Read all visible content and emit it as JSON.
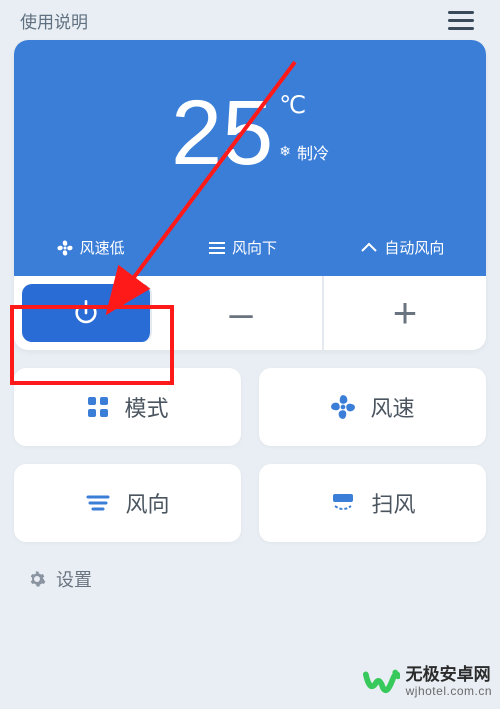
{
  "topbar": {
    "title": "使用说明"
  },
  "display": {
    "temp_value": "25",
    "temp_unit": "℃",
    "mode_label": "制冷",
    "status": {
      "fan_speed": "风速低",
      "wind_dir": "风向下",
      "auto_dir": "自动风向"
    }
  },
  "controls": {
    "minus": "–",
    "plus": "+"
  },
  "big_buttons": {
    "mode": "模式",
    "fan": "风速",
    "direction": "风向",
    "sweep": "扫风"
  },
  "settings": {
    "label": "设置"
  },
  "watermark": {
    "cn": "无极安卓网",
    "en": "wjhotel.com.cn"
  },
  "colors": {
    "accent": "#3b7ed8",
    "highlight": "#ff1a1a"
  }
}
